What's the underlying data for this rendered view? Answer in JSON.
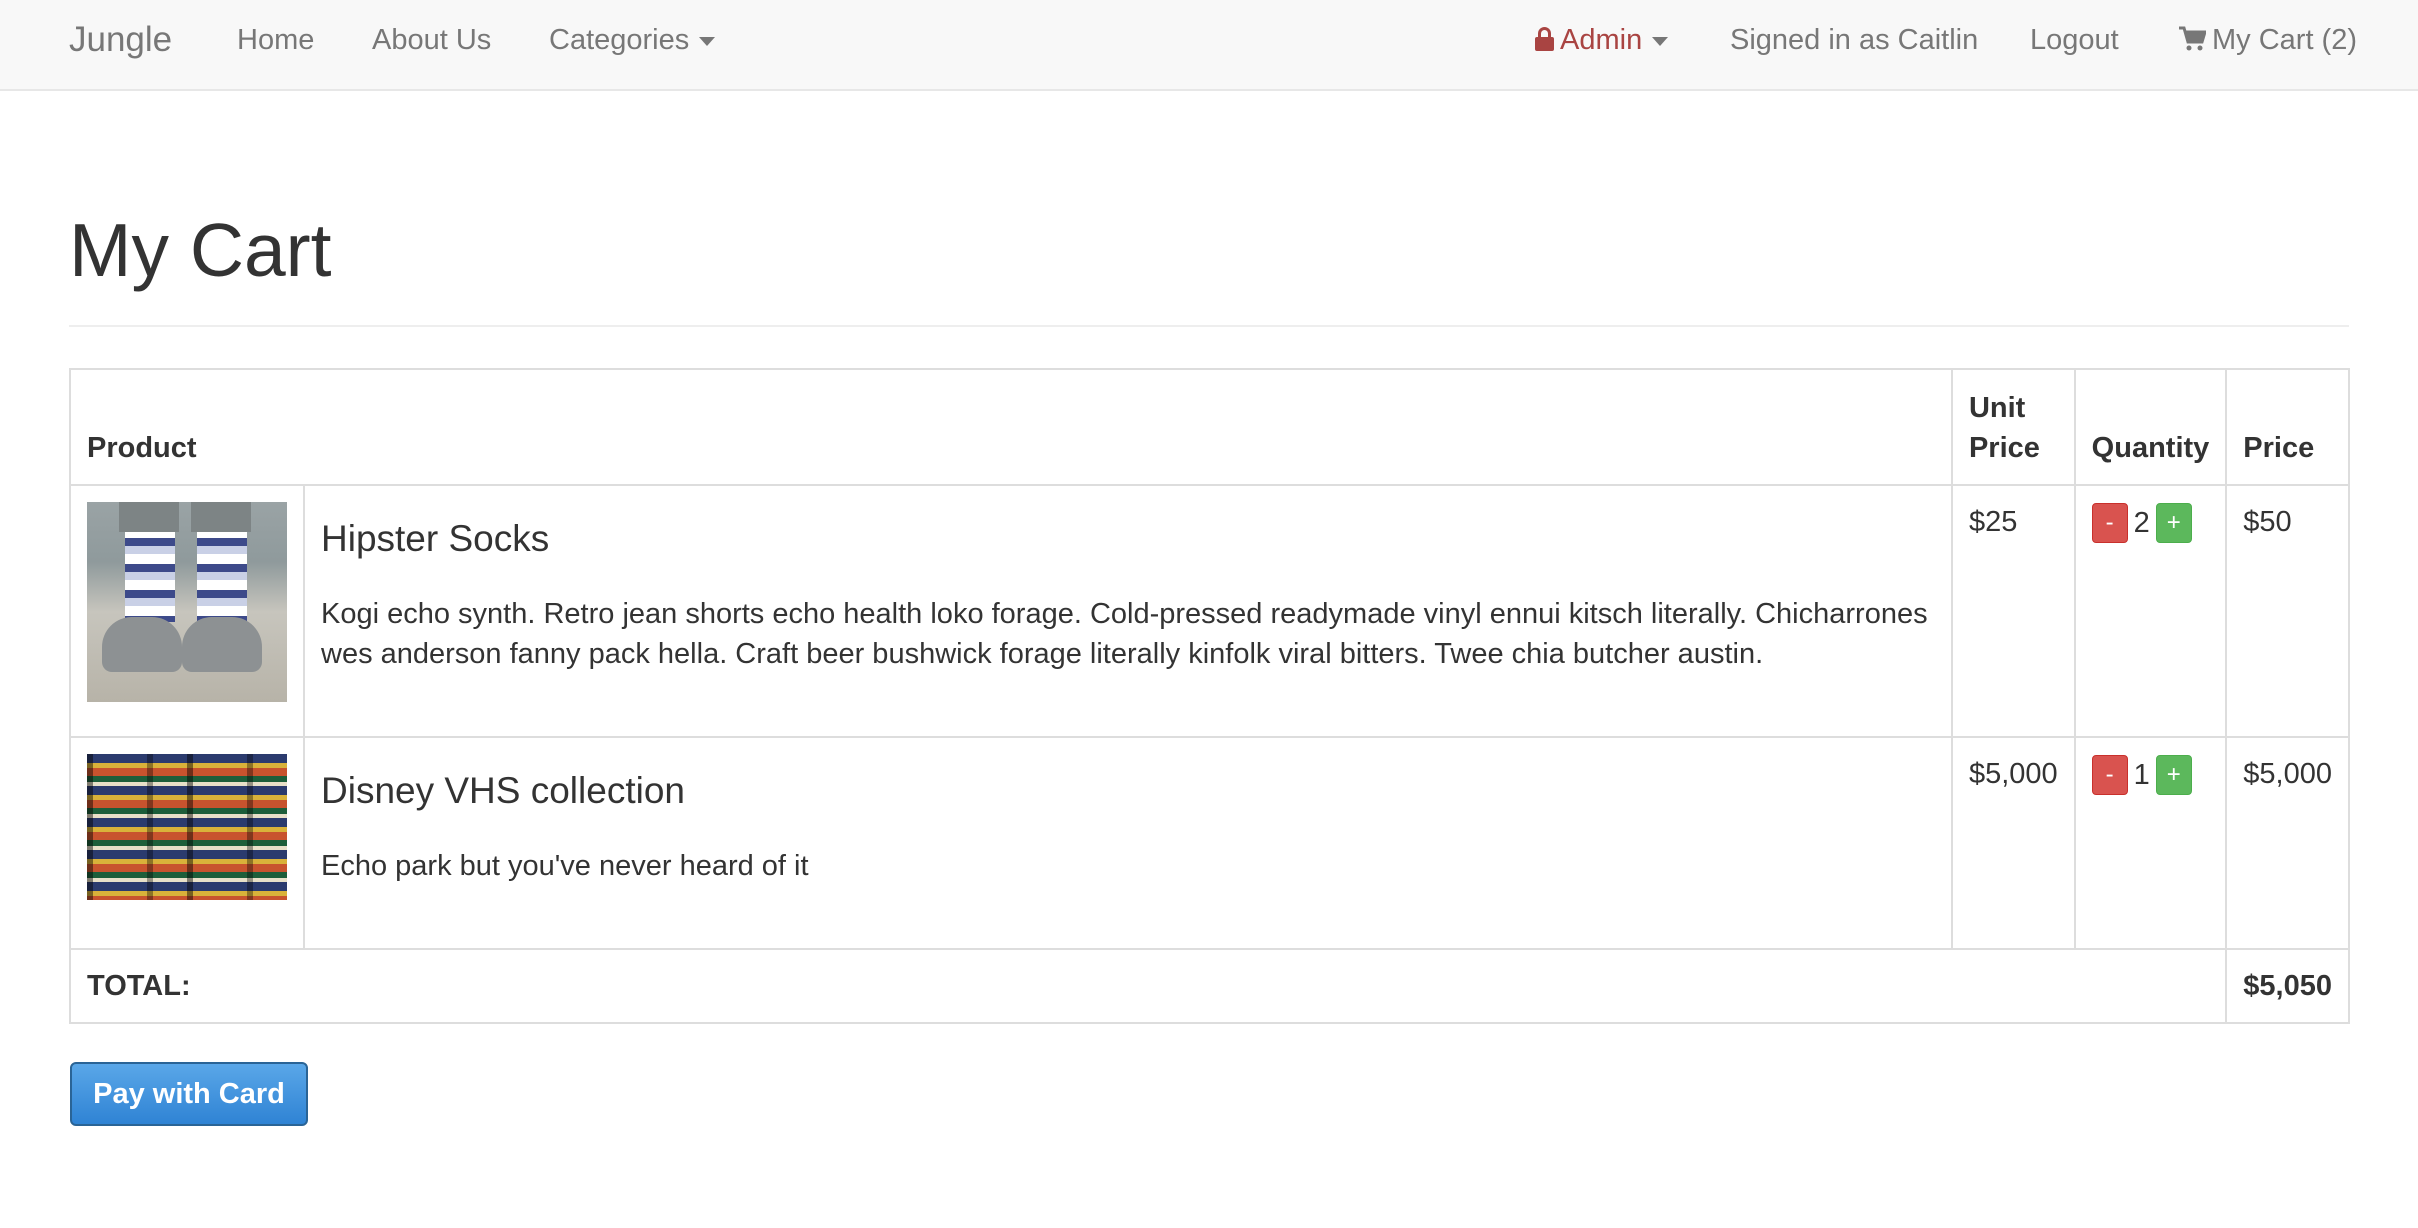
{
  "nav": {
    "brand": "Jungle",
    "home": "Home",
    "about": "About Us",
    "categories": "Categories",
    "admin": "Admin",
    "signed_in": "Signed in as Caitlin",
    "logout": "Logout",
    "cart": "My Cart (2)"
  },
  "page": {
    "title": "My Cart"
  },
  "table": {
    "headers": {
      "product": "Product",
      "unit_price": "Unit Price",
      "quantity": "Quantity",
      "price": "Price"
    },
    "rows": [
      {
        "name": "Hipster Socks",
        "description": "Kogi echo synth. Retro jean shorts echo health loko forage. Cold-pressed readymade vinyl ennui kitsch literally. Chicharrones wes anderson fanny pack hella. Craft beer bushwick forage literally kinfolk viral bitters. Twee chia butcher austin.",
        "unit_price": "$25",
        "quantity": "2",
        "price": "$50"
      },
      {
        "name": "Disney VHS collection",
        "description": "Echo park but you've never heard of it",
        "unit_price": "$5,000",
        "quantity": "1",
        "price": "$5,000"
      }
    ],
    "minus_label": "-",
    "plus_label": "+",
    "total_label": "TOTAL:",
    "total_value": "$5,050"
  },
  "actions": {
    "pay": "Pay with Card"
  },
  "colors": {
    "admin": "#a94442",
    "minus_button": "#d9534f",
    "plus_button": "#5cb85c",
    "pay_button": "#3a8fd9"
  },
  "icons": {
    "admin": "lock-icon",
    "cart": "shopping-cart-icon"
  }
}
